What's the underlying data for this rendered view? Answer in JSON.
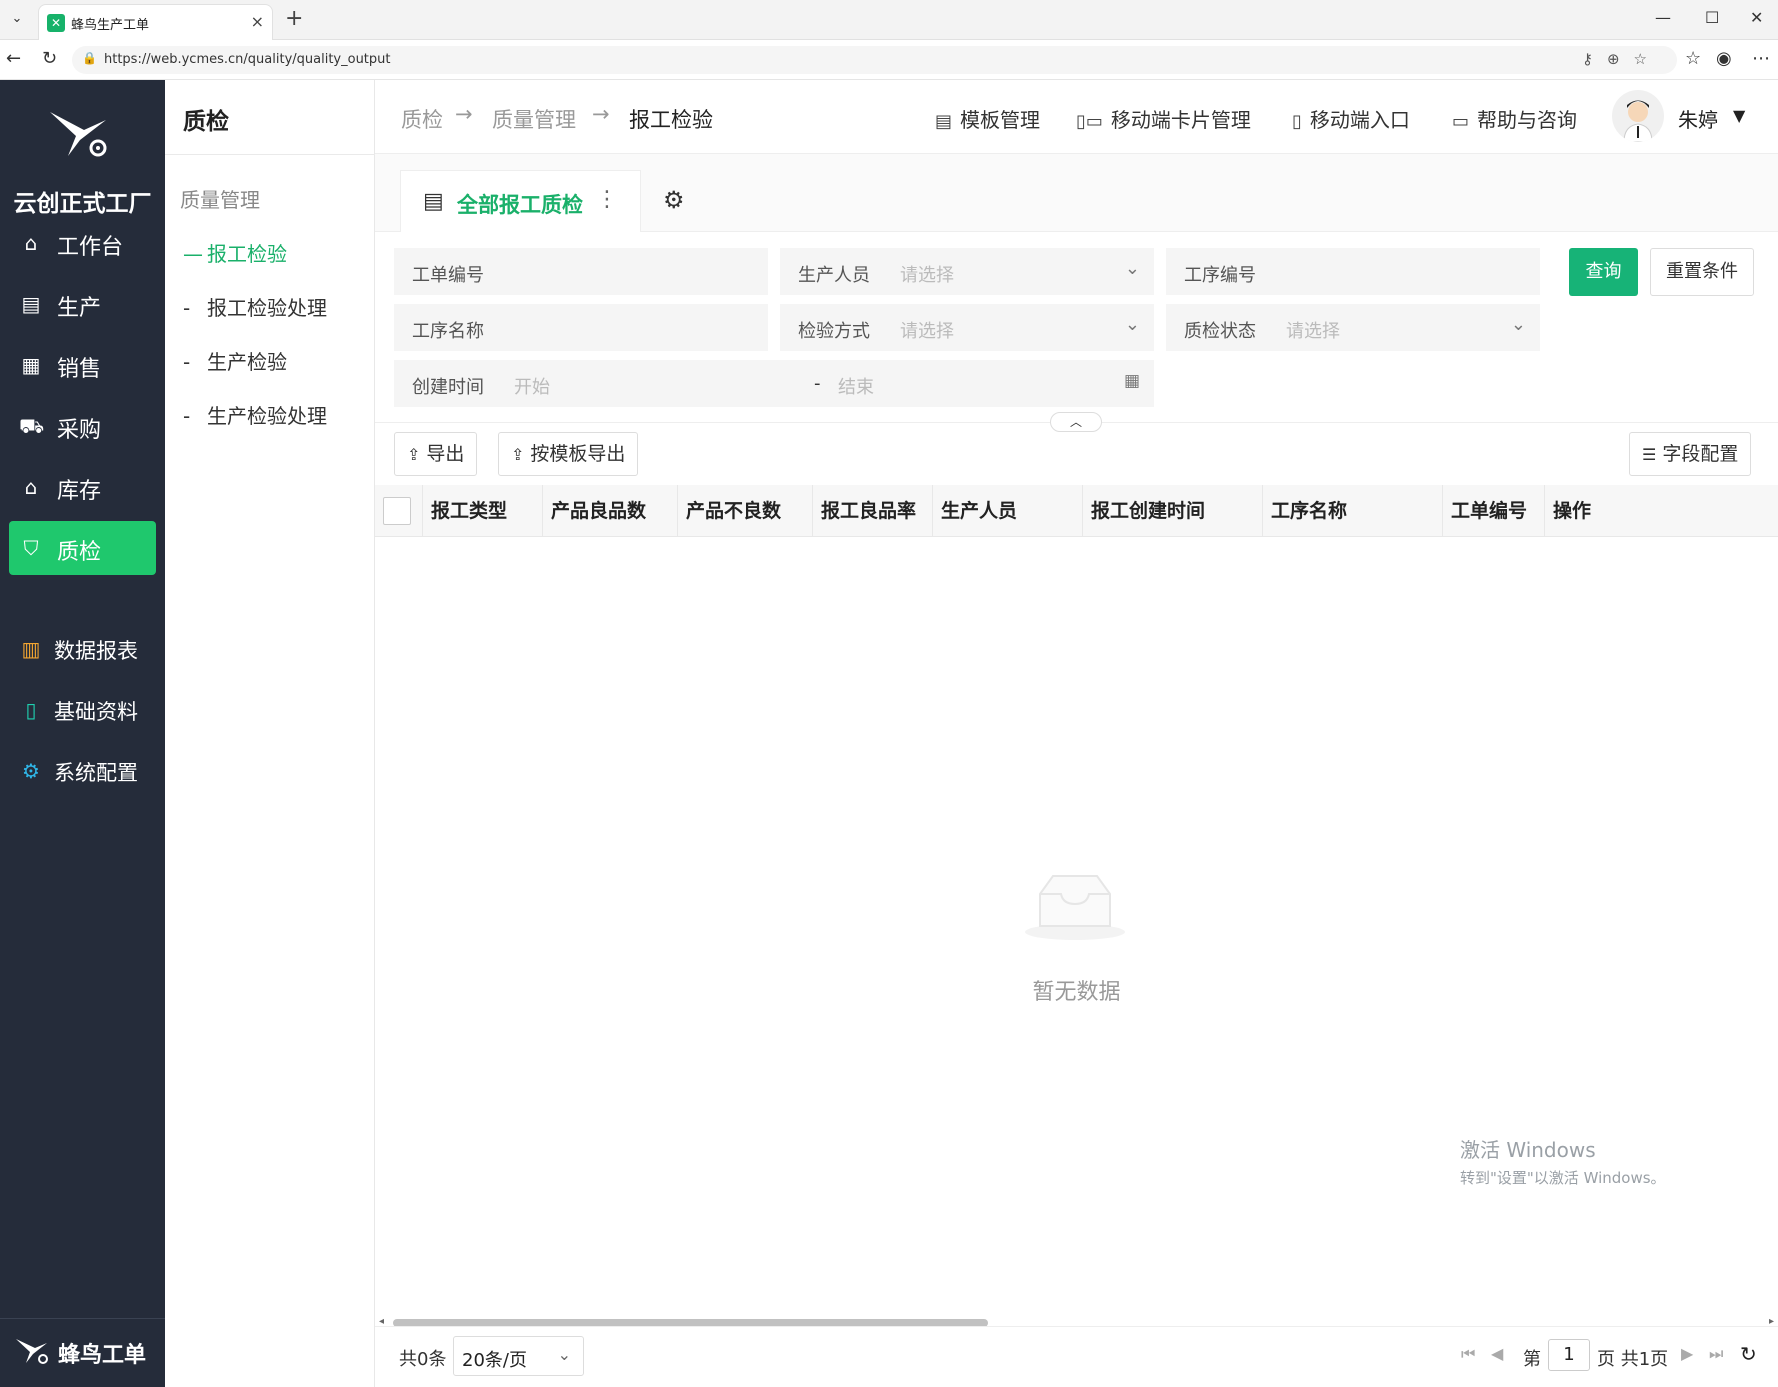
{
  "browser": {
    "tab_title": "蜂鸟生产工单",
    "url": "https://web.ycmes.cn/quality/quality_output"
  },
  "sidebar": {
    "factory_name": "云创正式工厂",
    "items": [
      {
        "label": "工作台",
        "icon": "home-icon"
      },
      {
        "label": "生产",
        "icon": "production-icon"
      },
      {
        "label": "销售",
        "icon": "sales-icon"
      },
      {
        "label": "采购",
        "icon": "cart-icon"
      },
      {
        "label": "库存",
        "icon": "warehouse-icon"
      },
      {
        "label": "质检",
        "icon": "shield-icon",
        "active": true
      },
      {
        "label": "数据报表",
        "icon": "bar-chart-icon"
      },
      {
        "label": "基础资料",
        "icon": "document-icon"
      },
      {
        "label": "系统配置",
        "icon": "gear-icon"
      }
    ],
    "footer_brand": "蜂鸟工单"
  },
  "subnav": {
    "title": "质检",
    "group": "质量管理",
    "items": [
      {
        "label": "报工检验",
        "active": true
      },
      {
        "label": "报工检验处理"
      },
      {
        "label": "生产检验"
      },
      {
        "label": "生产检验处理"
      }
    ]
  },
  "header": {
    "breadcrumb": [
      "质检",
      "质量管理",
      "报工检验"
    ],
    "arrow": "→",
    "links": {
      "template": "模板管理",
      "mobile_card": "移动端卡片管理",
      "mobile_entry": "移动端入口",
      "help": "帮助与咨询"
    },
    "user_name": "朱婷"
  },
  "view_tab": {
    "label": "全部报工质检"
  },
  "filters": {
    "work_order_no": "工单编号",
    "producer": "生产人员",
    "process_no": "工序编号",
    "process_name": "工序名称",
    "inspect_method": "检验方式",
    "qc_status": "质检状态",
    "created_time": "创建时间",
    "placeholder_select": "请选择",
    "placeholder_start": "开始",
    "placeholder_end": "结束",
    "range_sep": "-",
    "query": "查询",
    "reset": "重置条件"
  },
  "toolbar": {
    "export": "导出",
    "export_template": "按模板导出",
    "field_config": "字段配置"
  },
  "table": {
    "columns": [
      "报工类型",
      "产品良品数",
      "产品不良数",
      "报工良品率",
      "生产人员",
      "报工创建时间",
      "工序名称",
      "工单编号",
      "操作"
    ],
    "empty_text": "暂无数据"
  },
  "watermark": {
    "line1": "激活 Windows",
    "line2": "转到\"设置\"以激活 Windows。"
  },
  "pager": {
    "total": "共0条",
    "page_size": "20条/页",
    "page_prefix": "第",
    "current_page": "1",
    "page_suffix": "页 共1页"
  }
}
